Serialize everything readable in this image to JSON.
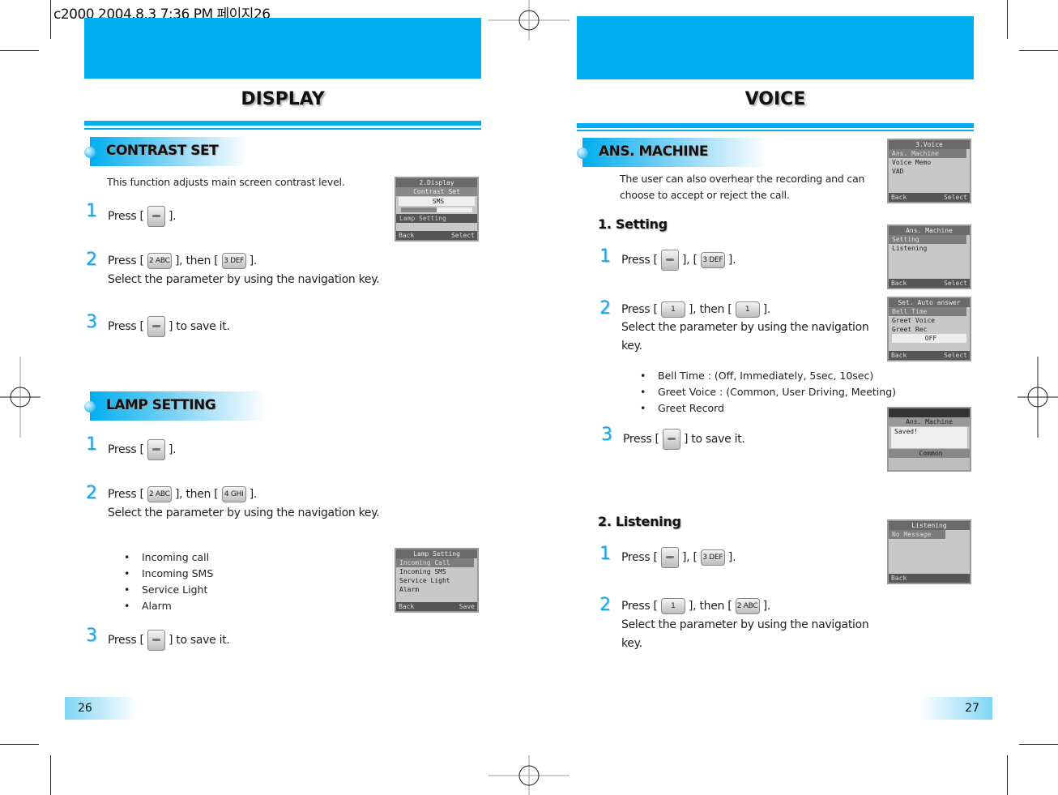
{
  "print_slug": "c2000  2004.8.3 7:36 PM 페이지26",
  "left_page": {
    "title": "DISPLAY",
    "page_number": "26",
    "sections": [
      {
        "heading": "CONTRAST SET",
        "description": "This function adjusts main screen contrast level.",
        "steps": [
          {
            "num": "1",
            "pre": "Press [",
            "post": "].",
            "keys": [
              "soft-key"
            ]
          },
          {
            "num": "2",
            "pre": "Press [",
            "mid": "], then [",
            "post": "].",
            "keys": [
              "2 ABC",
              "3 DEF"
            ],
            "line2": "Select the parameter by using the navigation key."
          },
          {
            "num": "3",
            "pre": "Press [",
            "post": "] to save it.",
            "keys": [
              "soft-key"
            ]
          }
        ],
        "screen": {
          "title": "2.Display",
          "subtitle": "Contrast Set",
          "value": "SMS",
          "items": [
            "Lamp Setting"
          ],
          "left_soft": "Back",
          "right_soft": "Select"
        }
      },
      {
        "heading": "LAMP SETTING",
        "steps": [
          {
            "num": "1",
            "pre": "Press [",
            "post": "].",
            "keys": [
              "soft-key"
            ]
          },
          {
            "num": "2",
            "pre": "Press [",
            "mid": "], then [",
            "post": "].",
            "keys": [
              "2 ABC",
              "4 GHI"
            ],
            "line2": "Select the parameter by using the navigation key."
          },
          {
            "num": "3",
            "pre": "Press [",
            "post": "] to save it.",
            "keys": [
              "soft-key"
            ]
          }
        ],
        "options": [
          "Incoming call",
          "Incoming SMS",
          "Service Light",
          "Alarm"
        ],
        "screen": {
          "title": "Lamp Setting",
          "items": [
            "Incoming Call",
            "Incoming SMS",
            "Service Light",
            "Alarm"
          ],
          "left_soft": "Back",
          "right_soft": "Save"
        }
      }
    ]
  },
  "right_page": {
    "title": "VOICE",
    "page_number": "27",
    "section": {
      "heading": "ANS. MACHINE",
      "description_line1": "The user can also overhear the recording and can",
      "description_line2": "choose to accept or reject the call.",
      "setting": {
        "heading": "1. Setting",
        "steps": [
          {
            "num": "1",
            "pre": "Press [",
            "mid": "], [",
            "post": "].",
            "keys": [
              "soft-key",
              "3 DEF"
            ]
          },
          {
            "num": "2",
            "pre": "Press [",
            "mid": "], then [",
            "post": "].",
            "keys": [
              "1",
              "1"
            ],
            "line2": "Select the parameter by using the navigation",
            "line3": "key."
          },
          {
            "num": "3",
            "pre": "Press [",
            "post": "] to save it.",
            "keys": [
              "soft-key"
            ]
          }
        ],
        "options": [
          "Bell Time : (Off, Immediately, 5sec, 10sec)",
          "Greet Voice : (Common, User Driving, Meeting)",
          "Greet Record"
        ]
      },
      "listening": {
        "heading": "2. Listening",
        "steps": [
          {
            "num": "1",
            "pre": "Press [",
            "mid": "], [",
            "post": "].",
            "keys": [
              "soft-key",
              "3 DEF"
            ]
          },
          {
            "num": "2",
            "pre": "Press [",
            "mid": "], then [",
            "post": "].",
            "keys": [
              "1",
              "2 ABC"
            ],
            "line2": "Select the parameter by using the navigation",
            "line3": "key."
          }
        ]
      },
      "screens": [
        {
          "title": "3.Voice",
          "items": [
            "Ans. Machine",
            "Voice Memo",
            "VAD"
          ],
          "left_soft": "Back",
          "right_soft": "Select"
        },
        {
          "title": "Ans. Machine",
          "items": [
            "Setting",
            "Listening"
          ],
          "left_soft": "Back",
          "right_soft": "Select"
        },
        {
          "title": "Set. Auto answer",
          "items": [
            "Bell Time",
            "Greet Voice",
            "Greet Rec"
          ],
          "value": "OFF",
          "left_soft": "Back",
          "right_soft": "Select"
        },
        {
          "title": "Ans. Machine",
          "items": [
            "Saved!"
          ],
          "value": "Common"
        },
        {
          "title": "Listening",
          "items": [
            "No Message"
          ],
          "left_soft": "Back"
        }
      ]
    }
  },
  "colors": {
    "accent": "#00aeef",
    "step_number": "#1ea5e3"
  }
}
